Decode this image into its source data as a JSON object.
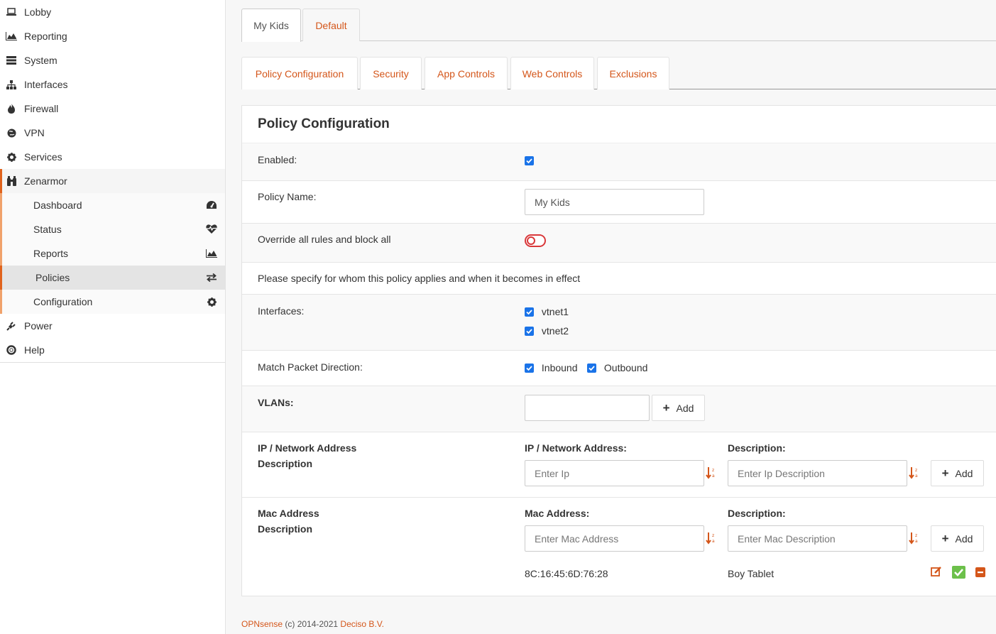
{
  "sidebar": {
    "items": [
      {
        "label": "Lobby",
        "icon": "laptop-icon"
      },
      {
        "label": "Reporting",
        "icon": "area-chart-icon"
      },
      {
        "label": "System",
        "icon": "server-icon"
      },
      {
        "label": "Interfaces",
        "icon": "sitemap-icon"
      },
      {
        "label": "Firewall",
        "icon": "fire-icon"
      },
      {
        "label": "VPN",
        "icon": "globe-icon"
      },
      {
        "label": "Services",
        "icon": "cog-icon"
      },
      {
        "label": "Zenarmor",
        "icon": "binoculars-icon"
      }
    ],
    "zenarmor_sub": [
      {
        "label": "Dashboard",
        "icon": "dashboard-icon"
      },
      {
        "label": "Status",
        "icon": "heartbeat-icon"
      },
      {
        "label": "Reports",
        "icon": "area-chart-icon"
      },
      {
        "label": "Policies",
        "icon": "exchange-icon"
      },
      {
        "label": "Configuration",
        "icon": "cog-icon"
      }
    ],
    "bottom_items": [
      {
        "label": "Power",
        "icon": "plug-icon"
      },
      {
        "label": "Help",
        "icon": "life-ring-icon"
      }
    ]
  },
  "top_tabs": [
    "My Kids",
    "Default"
  ],
  "sub_tabs": [
    "Policy Configuration",
    "Security",
    "App Controls",
    "Web Controls",
    "Exclusions"
  ],
  "panel": {
    "title": "Policy Configuration",
    "enabled_label": "Enabled:",
    "policy_name_label": "Policy Name:",
    "policy_name_value": "My Kids",
    "override_label": "Override all rules and block all",
    "specify_text": "Please specify for whom this policy applies and when it becomes in effect",
    "interfaces_label": "Interfaces:",
    "interfaces": [
      "vtnet1",
      "vtnet2"
    ],
    "direction_label": "Match Packet Direction:",
    "inbound": "Inbound",
    "outbound": "Outbound",
    "vlans_label": "VLANs:",
    "add_label": "Add",
    "ip_section_label_1": "IP / Network Address",
    "ip_section_label_2": "Description",
    "ip_col_label": "IP / Network Address:",
    "desc_col_label": "Description:",
    "ip_placeholder": "Enter Ip",
    "ip_desc_placeholder": "Enter Ip Description",
    "mac_section_label_1": "Mac Address",
    "mac_section_label_2": "Description",
    "mac_col_label": "Mac Address:",
    "mac_placeholder": "Enter Mac Address",
    "mac_desc_placeholder": "Enter Mac Description",
    "mac_entry_address": "8C:16:45:6D:76:28",
    "mac_entry_desc": "Boy Tablet"
  },
  "footer": {
    "brand": "OPNsense",
    "copy": " (c) 2014-2021 ",
    "company": "Deciso B.V."
  },
  "colors": {
    "accent": "#d4561a",
    "checkbox": "#1a73e8",
    "toggle_off": "#d9383a",
    "confirm_green": "#6cc04a"
  }
}
